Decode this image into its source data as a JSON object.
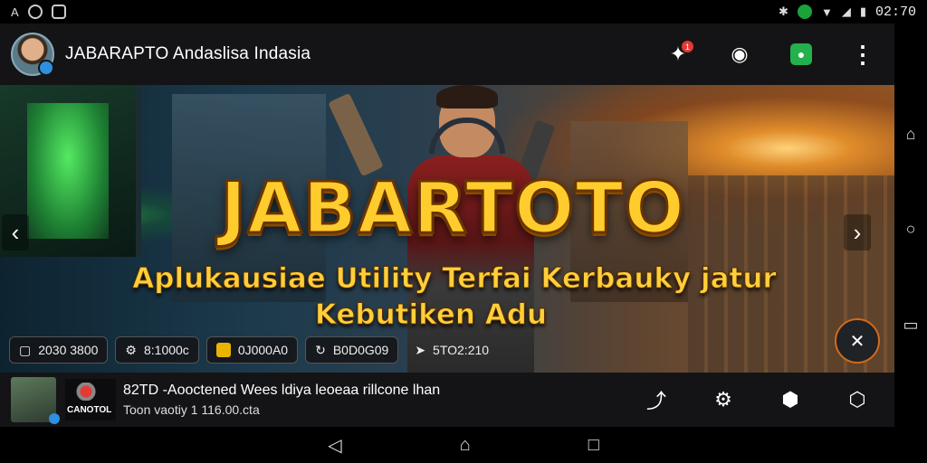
{
  "status_bar": {
    "left_icons": [
      "app-a-icon",
      "circle-app-icon",
      "image-icon"
    ],
    "left_glyph": "A",
    "right_icons": [
      "bluetooth-icon",
      "sync-icon",
      "wifi-icon",
      "signal-icon",
      "battery-icon"
    ],
    "clock": "02:70"
  },
  "header": {
    "title": "JABARAPTO Andaslisa Indasia",
    "notification_count": "1",
    "actions": [
      "notification-icon",
      "support-icon",
      "chat-icon",
      "more-icon"
    ]
  },
  "banner": {
    "title": "JABARTOTO",
    "subtitle_line1": "Aplukausiae Utility Terfai Kerbauky jatur",
    "subtitle_line2": "Kebutiken Adu",
    "chips": [
      {
        "icon": "square-icon",
        "label": "2030 3800"
      },
      {
        "icon": "controller-icon",
        "label": "8:1000c"
      },
      {
        "icon": "folder-icon",
        "label": "0J000A0"
      },
      {
        "icon": "refresh-icon",
        "label": "B0D0G09"
      },
      {
        "icon": "arrow-icon",
        "label": "5TO2:210"
      }
    ]
  },
  "bottom_bar": {
    "logo_label": "CANOTOL",
    "line1": "82TD -Aooctened Wees ldiya leoeaa rillcone lhan",
    "line2": "Toon vaotiy 1 116.00.cta",
    "actions": [
      "share-icon",
      "settings-icon",
      "record-icon",
      "shield-icon"
    ]
  },
  "colors": {
    "accent_gold": "#ffcc2e",
    "bar_bg": "#141416",
    "notification_red": "#e53935",
    "chat_green": "#22b14c"
  }
}
